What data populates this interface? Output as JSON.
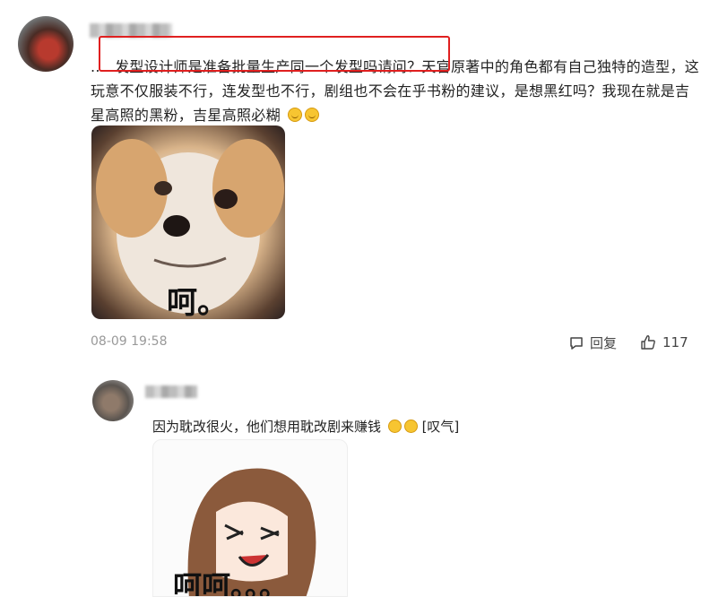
{
  "comment1": {
    "text": "…发型设计师是准备批量生产同一个发型吗请问？天官原著中的角色都有自己独特的造型，这玩意不仅服装不行，连发型也不行，剧组也不会在乎书粉的建议，是想黑红吗？我现在就是吉星高照的黑粉，吉星高照必糊",
    "text_prefix": "..",
    "image_caption": "呵。",
    "timestamp": "08-09 19:58",
    "reply_label": "回复",
    "like_count": "117"
  },
  "comment2": {
    "text": "因为耽改很火，他们想用耽改剧来赚钱",
    "text_suffix": "[叹气]",
    "image_caption": "呵呵。。。"
  },
  "colors": {
    "highlight": "#e02020",
    "muted": "#999999",
    "text": "#222222"
  },
  "icons": [
    "comment-icon",
    "thumbs-up-icon",
    "smile-emoji"
  ]
}
